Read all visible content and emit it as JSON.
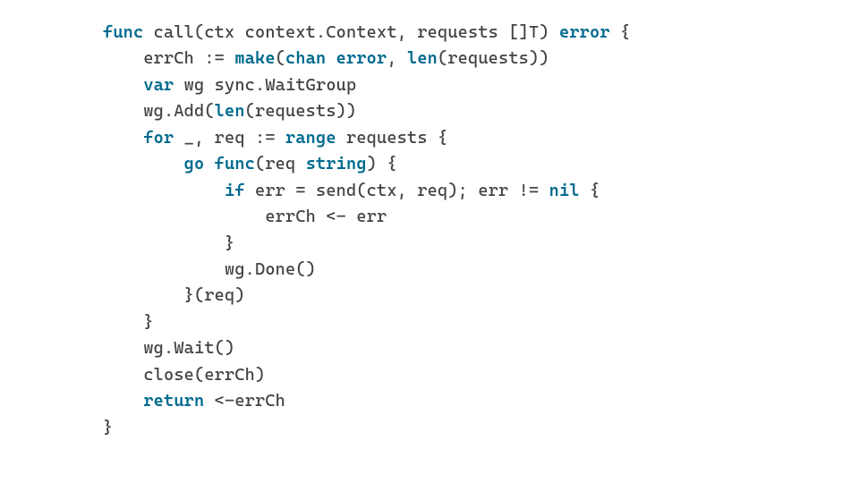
{
  "code": {
    "lang": "go",
    "colors": {
      "keyword": "#006b8f",
      "text": "#434343",
      "background": "#ffffff"
    },
    "tokens": [
      [
        {
          "t": "func ",
          "c": "kw"
        },
        {
          "t": "call(ctx context.Context, requests []T) ",
          "c": "fn"
        },
        {
          "t": "error",
          "c": "kw"
        },
        {
          "t": " {",
          "c": "fn"
        }
      ],
      [
        {
          "t": "    errCh := ",
          "c": "fn"
        },
        {
          "t": "make",
          "c": "kw"
        },
        {
          "t": "(",
          "c": "fn"
        },
        {
          "t": "chan error",
          "c": "kw"
        },
        {
          "t": ", ",
          "c": "fn"
        },
        {
          "t": "len",
          "c": "kw"
        },
        {
          "t": "(requests))",
          "c": "fn"
        }
      ],
      [
        {
          "t": "    ",
          "c": "fn"
        },
        {
          "t": "var",
          "c": "kw"
        },
        {
          "t": " wg sync.WaitGroup",
          "c": "fn"
        }
      ],
      [
        {
          "t": "    wg.Add(",
          "c": "fn"
        },
        {
          "t": "len",
          "c": "kw"
        },
        {
          "t": "(requests))",
          "c": "fn"
        }
      ],
      [
        {
          "t": "    ",
          "c": "fn"
        },
        {
          "t": "for",
          "c": "kw"
        },
        {
          "t": " _, req := ",
          "c": "fn"
        },
        {
          "t": "range",
          "c": "kw"
        },
        {
          "t": " requests {",
          "c": "fn"
        }
      ],
      [
        {
          "t": "        ",
          "c": "fn"
        },
        {
          "t": "go func",
          "c": "kw"
        },
        {
          "t": "(req ",
          "c": "fn"
        },
        {
          "t": "string",
          "c": "kw"
        },
        {
          "t": ") {",
          "c": "fn"
        }
      ],
      [
        {
          "t": "            ",
          "c": "fn"
        },
        {
          "t": "if",
          "c": "kw"
        },
        {
          "t": " err = send(ctx, req); err != ",
          "c": "fn"
        },
        {
          "t": "nil",
          "c": "kw"
        },
        {
          "t": " {",
          "c": "fn"
        }
      ],
      [
        {
          "t": "                errCh <- err",
          "c": "fn"
        }
      ],
      [
        {
          "t": "            }",
          "c": "fn"
        }
      ],
      [
        {
          "t": "            wg.Done()",
          "c": "fn"
        }
      ],
      [
        {
          "t": "        }(req)",
          "c": "fn"
        }
      ],
      [
        {
          "t": "    }",
          "c": "fn"
        }
      ],
      [
        {
          "t": "    wg.Wait()",
          "c": "fn"
        }
      ],
      [
        {
          "t": "    close(errCh)",
          "c": "fn"
        }
      ],
      [
        {
          "t": "    ",
          "c": "fn"
        },
        {
          "t": "return",
          "c": "kw"
        },
        {
          "t": " <-errCh",
          "c": "fn"
        }
      ],
      [
        {
          "t": "}",
          "c": "fn"
        }
      ]
    ]
  }
}
